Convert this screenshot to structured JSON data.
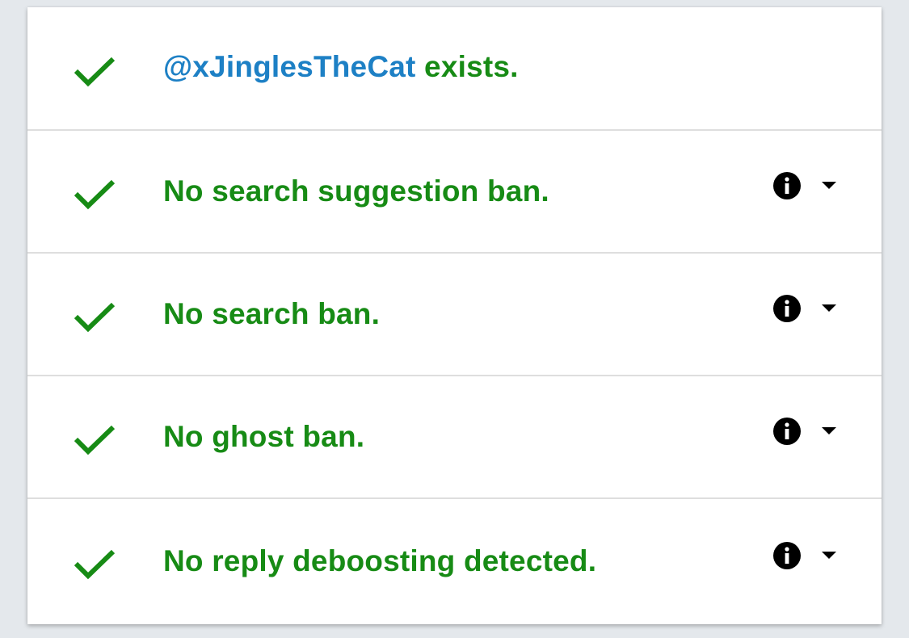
{
  "colors": {
    "success": "#178b15",
    "link": "#1d80c5",
    "background": "#e4e8ec",
    "card": "#ffffff"
  },
  "checks": [
    {
      "icon": "check-icon",
      "handle": "@xJinglesTheCat",
      "label": " exists.",
      "has_details": false
    },
    {
      "icon": "check-icon",
      "label": "No search suggestion ban.",
      "has_details": true
    },
    {
      "icon": "check-icon",
      "label": "No search ban.",
      "has_details": true
    },
    {
      "icon": "check-icon",
      "label": "No ghost ban.",
      "has_details": true
    },
    {
      "icon": "check-icon",
      "label": "No reply deboosting detected.",
      "has_details": true
    }
  ]
}
